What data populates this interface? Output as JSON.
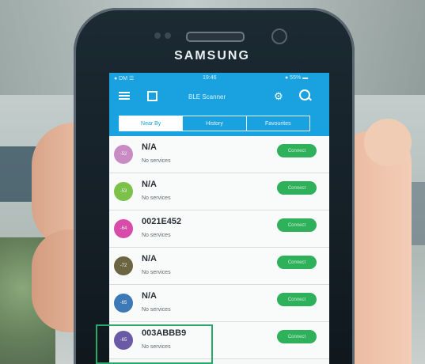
{
  "phone": {
    "brand": "SAMSUNG"
  },
  "status_bar": {
    "carrier": "● DM ☰",
    "time": "19:46",
    "battery": "● 55% ▬"
  },
  "app_bar": {
    "title": "BLE Scanner"
  },
  "tabs": [
    {
      "label": "Near By",
      "active": true
    },
    {
      "label": "History",
      "active": false
    },
    {
      "label": "Favourites",
      "active": false
    }
  ],
  "devices": [
    {
      "rssi": "-52",
      "name": "N/A",
      "services": "No services",
      "button": "Connect",
      "color": "#c98bc4"
    },
    {
      "rssi": "-53",
      "name": "N/A",
      "services": "No services",
      "button": "Connect",
      "color": "#7cc24a"
    },
    {
      "rssi": "-64",
      "name": "0021E452",
      "services": "No services",
      "button": "Connect",
      "color": "#d84ca9"
    },
    {
      "rssi": "-72",
      "name": "N/A",
      "services": "No services",
      "button": "Connect",
      "color": "#6b6542"
    },
    {
      "rssi": "-65",
      "name": "N/A",
      "services": "No services",
      "button": "Connect",
      "color": "#3d79b6"
    },
    {
      "rssi": "-65",
      "name": "003ABBB9",
      "services": "No services",
      "button": "Connect",
      "color": "#6a5aa6"
    }
  ],
  "colors": {
    "accent": "#1aa1df",
    "connect": "#2fb05b",
    "highlight": "#2aa86a"
  }
}
